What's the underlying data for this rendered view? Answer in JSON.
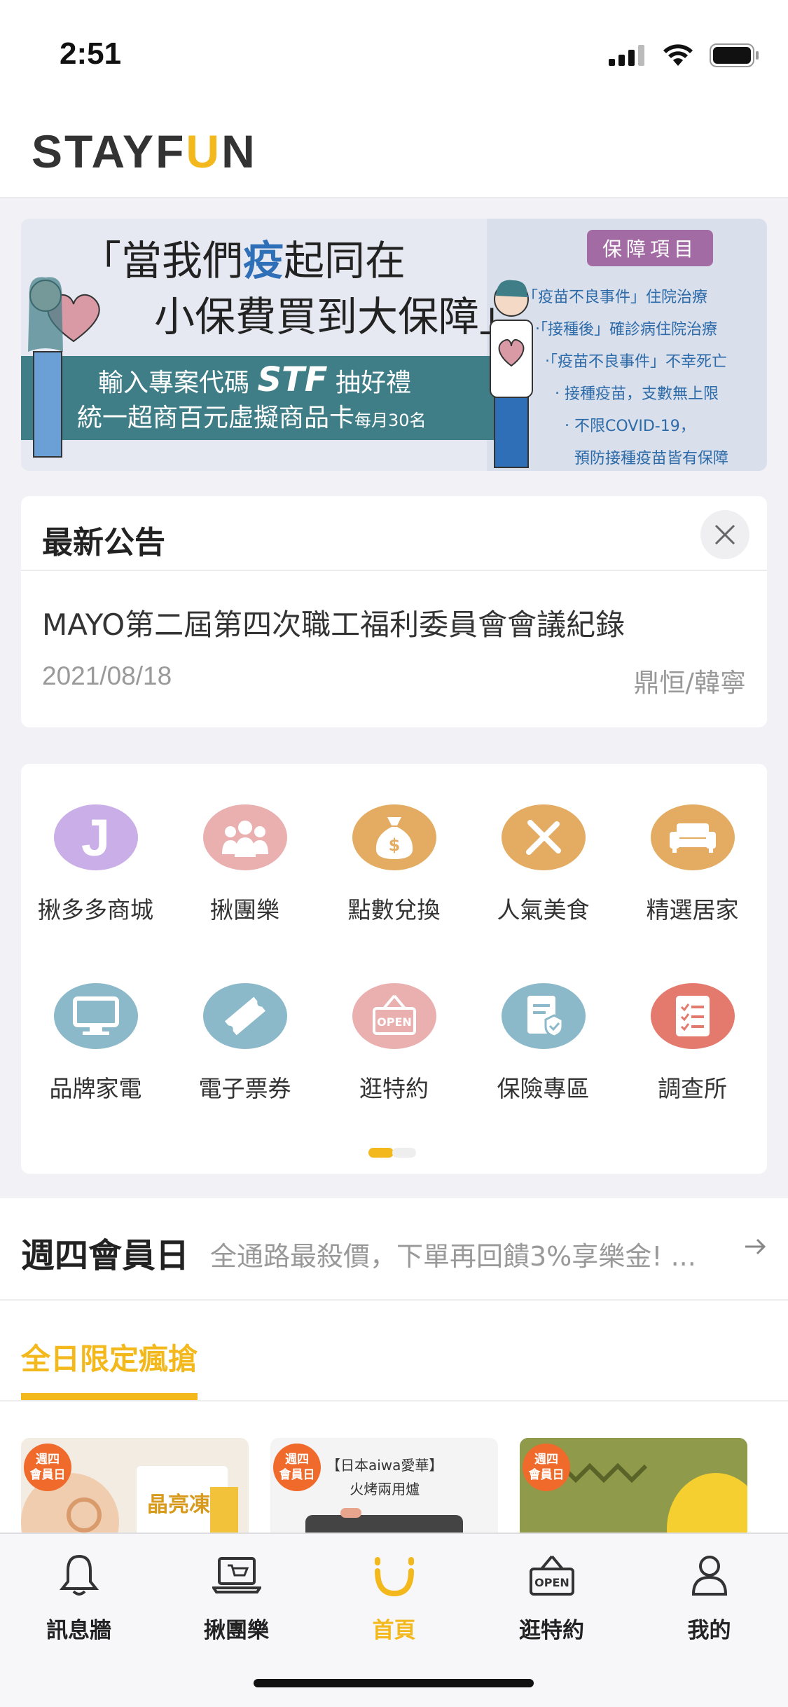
{
  "status_bar": {
    "time": "2:51"
  },
  "header": {
    "logo_left": "STAYF",
    "logo_u": "U",
    "logo_right": "N"
  },
  "banner": {
    "headline_line1_pre": "「當我們",
    "headline_line1_hl": "疫",
    "headline_line1_post": "起同在",
    "headline_line2": "小保費買到大保障」",
    "promo_line1_pre": "輸入專案代碼 ",
    "promo_code": "STF",
    "promo_line1_post": " 抽好禮",
    "promo_line2": "統一超商百元虛擬商品卡",
    "promo_line2_small": "每月30名",
    "tag": "保障項目",
    "items": [
      "‧「疫苗不良事件」住院治療",
      "‧「接種後」確診病住院治療",
      "‧「疫苗不良事件」不幸死亡",
      "‧ 接種疫苗，支數無上限",
      "‧ 不限COVID-19，",
      "預防接種疫苗皆有保障"
    ]
  },
  "announcement": {
    "title": "最新公告",
    "text": "MAYO第二屆第四次職工福利委員會會議紀錄",
    "date": "2021/08/18",
    "author": "鼎恒/韓寧"
  },
  "menu": {
    "items": [
      {
        "label": "揪多多商城",
        "icon": "j-icon",
        "color": "#c9aee8"
      },
      {
        "label": "揪團樂",
        "icon": "group-icon",
        "color": "#eab0b0"
      },
      {
        "label": "點數兌換",
        "icon": "money-bag-icon",
        "color": "#e3ac62"
      },
      {
        "label": "人氣美食",
        "icon": "utensils-icon",
        "color": "#e3ac62"
      },
      {
        "label": "精選居家",
        "icon": "sofa-icon",
        "color": "#e3ac62"
      },
      {
        "label": "品牌家電",
        "icon": "monitor-icon",
        "color": "#8bb9c9"
      },
      {
        "label": "電子票券",
        "icon": "ticket-icon",
        "color": "#8bb9c9"
      },
      {
        "label": "逛特約",
        "icon": "open-sign-icon",
        "color": "#eab0b0"
      },
      {
        "label": "保險專區",
        "icon": "insurance-icon",
        "color": "#8bb9c9"
      },
      {
        "label": "調查所",
        "icon": "checklist-icon",
        "color": "#e4796d"
      }
    ]
  },
  "promo": {
    "title": "週四會員日",
    "text": "全通路最殺價，下單再回饋3%享樂金! ...",
    "tab_active": "全日限定瘋搶"
  },
  "products": [
    {
      "badge": "週四\n會員日",
      "title": "晶亮凍"
    },
    {
      "badge": "週四\n會員日",
      "title": "【日本aiwa愛華】\n火烤兩用爐"
    },
    {
      "badge": "週四\n會員日",
      "title": ""
    }
  ],
  "tab_bar": {
    "items": [
      {
        "label": "訊息牆",
        "icon": "bell-icon"
      },
      {
        "label": "揪團樂",
        "icon": "laptop-cart-icon"
      },
      {
        "label": "首頁",
        "icon": "home-u-icon",
        "active": true
      },
      {
        "label": "逛特約",
        "icon": "open-sign-icon"
      },
      {
        "label": "我的",
        "icon": "person-icon"
      }
    ]
  },
  "colors": {
    "accent": "#f3b81c",
    "badge": "#ef6a2b",
    "banner_teal": "#3f7e86"
  }
}
